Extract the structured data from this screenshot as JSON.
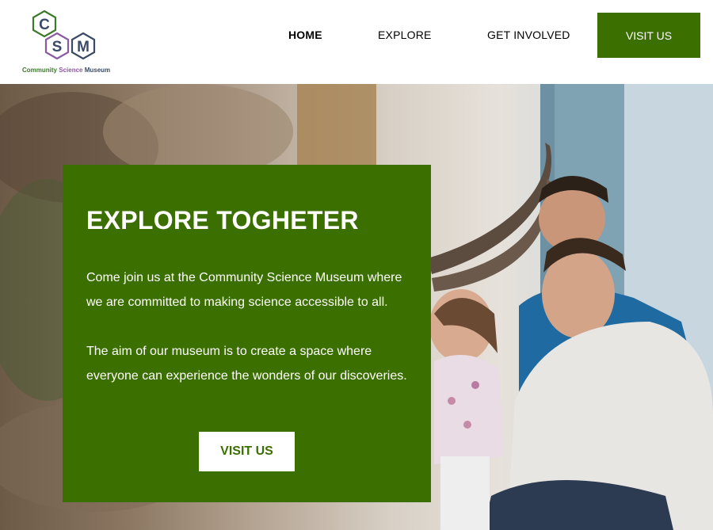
{
  "brand": {
    "logo_letters": [
      "C",
      "S",
      "M"
    ],
    "name_words": [
      "Community",
      "Science",
      "Museum"
    ],
    "colors": {
      "green": "#3b6f00",
      "logo_green": "#3c7a2a",
      "logo_purple": "#8a5aa0",
      "logo_navy": "#3a4a66"
    }
  },
  "nav": {
    "items": [
      {
        "label": "HOME",
        "active": true
      },
      {
        "label": "EXPLORE",
        "active": false
      },
      {
        "label": "GET INVOLVED",
        "active": false
      }
    ],
    "cta_label": "VISIT US"
  },
  "hero": {
    "title": "EXPLORE TOGHETER",
    "paragraphs": [
      "Come join us at the Community Science Museum where we are committed to making science accessible to all.",
      "The aim of our museum is to create a space where everyone can experience the wonders of our discoveries."
    ],
    "button_label": "VISIT US",
    "image_description": "family-looking-at-mammoth-tusks"
  }
}
